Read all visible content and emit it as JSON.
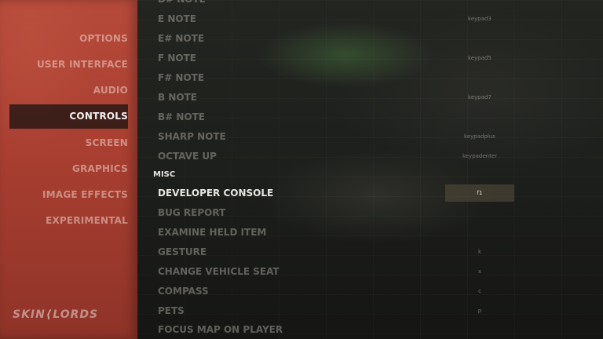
{
  "sidebar": {
    "items": [
      {
        "label": "OPTIONS"
      },
      {
        "label": "USER INTERFACE"
      },
      {
        "label": "AUDIO"
      },
      {
        "label": "CONTROLS"
      },
      {
        "label": "SCREEN"
      },
      {
        "label": "GRAPHICS"
      },
      {
        "label": "IMAGE EFFECTS"
      },
      {
        "label": "EXPERIMENTAL"
      }
    ],
    "active_item": "CONTROLS"
  },
  "logo": {
    "left": "SKIN",
    "right": "LORDS"
  },
  "notes_rows": [
    {
      "label": "E NOTE",
      "key": "keypad3"
    },
    {
      "label": "E# NOTE",
      "key": ""
    },
    {
      "label": "F NOTE",
      "key": "keypad5"
    },
    {
      "label": "F# NOTE",
      "key": ""
    },
    {
      "label": "B NOTE",
      "key": "keypad7"
    },
    {
      "label": "B# NOTE",
      "key": ""
    },
    {
      "label": "SHARP NOTE",
      "key": "keypadplus"
    },
    {
      "label": "OCTAVE UP",
      "key": "keypadenter"
    }
  ],
  "misc": {
    "header": "MISC",
    "rows": [
      {
        "label": "DEVELOPER CONSOLE",
        "key": "f1"
      },
      {
        "label": "BUG REPORT",
        "key": ""
      },
      {
        "label": "EXAMINE HELD ITEM",
        "key": ""
      },
      {
        "label": "GESTURE",
        "key": "k"
      },
      {
        "label": "CHANGE VEHICLE SEAT",
        "key": "x"
      },
      {
        "label": "COMPASS",
        "key": "c"
      },
      {
        "label": "PETS",
        "key": "p"
      },
      {
        "label": "FOCUS MAP ON PLAYER",
        "key": ""
      }
    ]
  },
  "colors": {
    "sidebar": "#b64a3a",
    "active_nav_bg": "#1e1412",
    "focused_bind_bg": "#5a503e"
  }
}
